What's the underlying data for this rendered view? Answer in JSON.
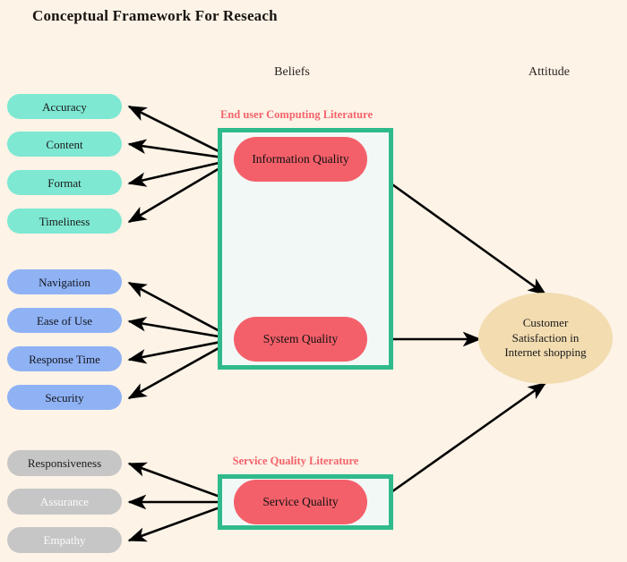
{
  "page": {
    "title": "Conceptual Framework For Reseach",
    "background_color": "#fdf3e7"
  },
  "column_labels": {
    "beliefs": "Beliefs",
    "attitude": "Attitude"
  },
  "literature_labels": {
    "end_user": "End user Computing Literature",
    "service": "Service Quality Literature"
  },
  "groups": [
    {
      "id": "information-quality",
      "core": "Information Quality",
      "color": "#f4606a",
      "indicator_color": "#7ee8d2",
      "indicators": [
        "Accuracy",
        "Content",
        "Format",
        "Timeliness"
      ]
    },
    {
      "id": "system-quality",
      "core": "System Quality",
      "color": "#f4606a",
      "indicator_color": "#8fb2f5",
      "indicators": [
        "Navigation",
        "Ease of Use",
        "Response Time",
        "Security"
      ]
    },
    {
      "id": "service-quality",
      "core": "Service Quality",
      "color": "#f4606a",
      "indicator_color": "#c6c6c6",
      "indicators": [
        "Responsiveness",
        "Assurance",
        "Empathy"
      ]
    }
  ],
  "outcome": {
    "line1": "Customer",
    "line2": "Satisfaction in",
    "line3": "Internet shopping",
    "color": "#f2dcb0"
  },
  "colors": {
    "accent_red": "#f4606a",
    "accent_green": "#2fba8c",
    "teal": "#7ee8d2",
    "blue": "#8fb2f5",
    "gray": "#c6c6c6",
    "wheat": "#f2dcb0",
    "arrow": "#000000"
  }
}
